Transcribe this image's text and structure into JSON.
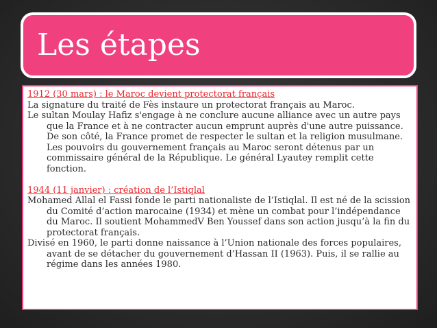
{
  "slide": {
    "title": "Les étapes",
    "sections": [
      {
        "heading": "1912 (30 mars) : le Maroc devient protectorat français",
        "paragraphs": [
          "La signature du traité de Fès instaure un protectorat français au Maroc.",
          " Le sultan Moulay Hafiz s'engage à ne conclure aucune alliance avec un autre pays que la France et à ne contracter aucun emprunt auprès d'une autre puissance. De son côté, la France promet de respecter le sultan et la religion musulmane. Les pouvoirs du gouvernement français au Maroc seront détenus par un commissaire général de la République. Le général Lyautey remplit cette fonction."
        ]
      },
      {
        "heading": "1944 (11 janvier) : création de l’Istiqlal",
        "paragraphs": [
          "Mohamed Allal el Fassi fonde le parti nationaliste de l’Istiqlal. Il est né de la scission du Comité d’action marocaine (1934) et mène un combat pour l’indépendance du Maroc. Il soutient MohammedV Ben Youssef dans son action jusqu’à la fin du protectorat français.",
          "Divisé en 1960, le parti donne naissance à l’Union nationale des forces populaires, avant de se détacher du gouvernement d’Hassan II (1963). Puis, il se rallie au régime dans les années 1980."
        ]
      }
    ]
  },
  "colors": {
    "title_bg": "#f0407e",
    "heading": "#e8262d",
    "background": "#2c2c2c"
  }
}
